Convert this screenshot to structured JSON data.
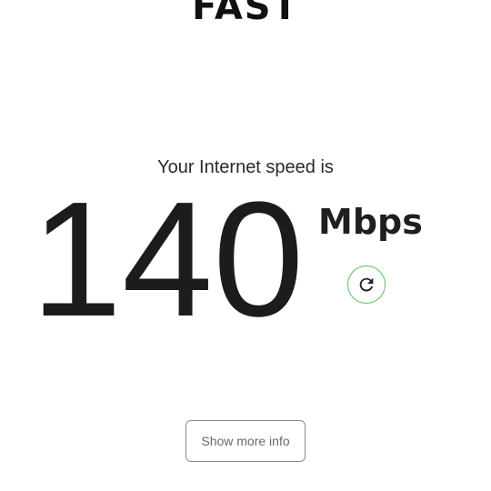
{
  "brand": {
    "logo_text": "FAST"
  },
  "speed": {
    "caption": "Your Internet speed is",
    "value": "140",
    "units": "Mbps"
  },
  "refresh": {
    "icon": "refresh-icon",
    "accent_color": "#5cc25c"
  },
  "actions": {
    "more_info_label": "Show more info"
  }
}
